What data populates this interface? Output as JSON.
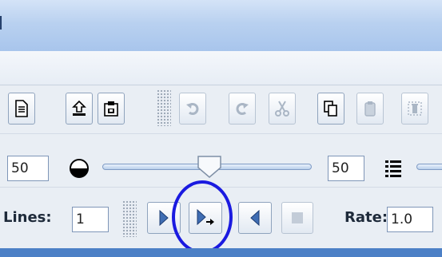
{
  "window": {
    "title": "l"
  },
  "toolbar": {
    "icons": [
      "document-icon",
      "upload-icon",
      "clipboard-lock-icon",
      "undo-icon",
      "redo-icon",
      "cut-icon",
      "copy-icon",
      "paste-icon",
      "delete-icon"
    ]
  },
  "controls": {
    "left_value": "50",
    "right_value": "50",
    "slider_level_percent": 50
  },
  "playback": {
    "lines_label": "Lines:",
    "lines_value": "1",
    "rate_label": "Rate:",
    "rate_value": "1.0"
  },
  "colors": {
    "highlight_circle": "#1a1ae0",
    "accent": "#4c80c6"
  }
}
